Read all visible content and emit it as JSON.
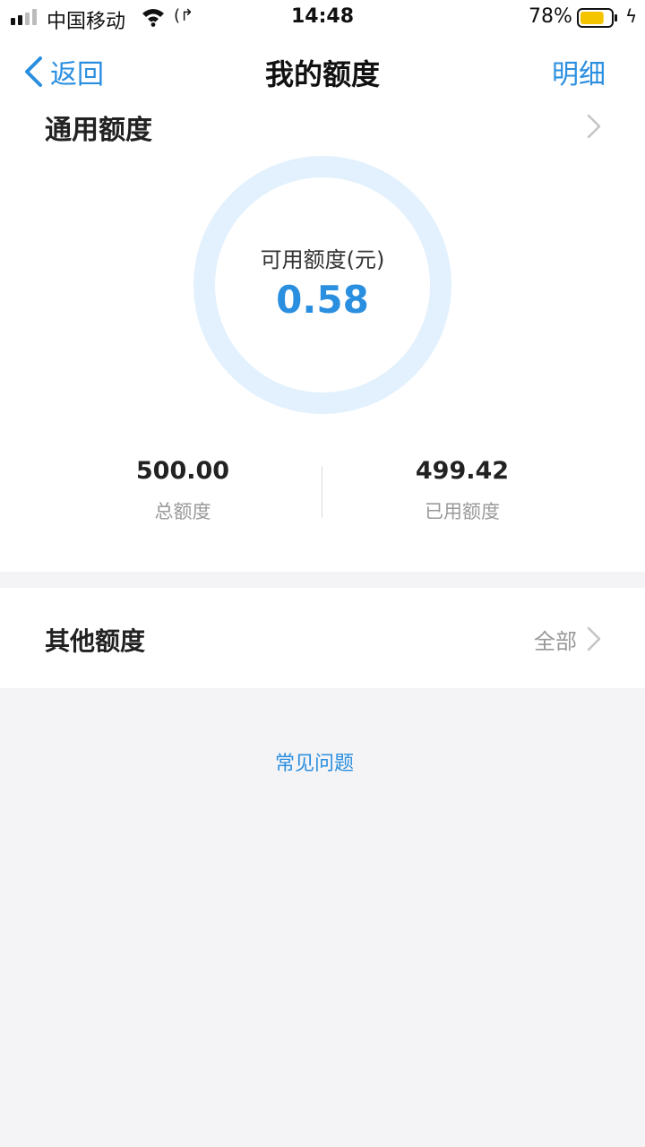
{
  "status_bar": {
    "carrier": "中国移动",
    "time": "14:48",
    "battery_percent": "78%",
    "battery_level": 0.78,
    "icons": [
      "signal-icon",
      "wifi-icon",
      "call-forward-icon",
      "battery-icon",
      "charging-bolt-icon"
    ]
  },
  "nav": {
    "back_label": "返回",
    "title": "我的额度",
    "detail_label": "明细"
  },
  "general_quota": {
    "section_title": "通用额度",
    "available_label": "可用额度(元)",
    "available_value": "0.58",
    "total_value": "500.00",
    "total_label": "总额度",
    "used_value": "499.42",
    "used_label": "已用额度"
  },
  "other_quota": {
    "section_title": "其他额度",
    "all_label": "全部"
  },
  "faq_label": "常见问题",
  "colors": {
    "accent": "#2b8fe0",
    "ring": "#e2f1fd",
    "background": "#f4f4f6",
    "battery": "#f5c400"
  }
}
